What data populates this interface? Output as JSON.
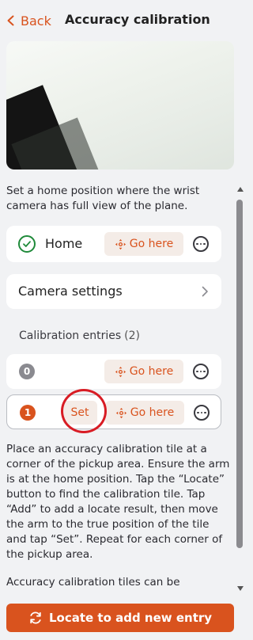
{
  "header": {
    "back_label": "Back",
    "title": "Accuracy calibration"
  },
  "intro_text": "Set a home position where the wrist camera has full view of the plane.",
  "home": {
    "label": "Home",
    "status_icon": "check-circle-icon",
    "goto_label": "Go here"
  },
  "camera_settings": {
    "label": "Camera settings"
  },
  "entries_section": {
    "title": "Calibration entries",
    "count": "(2)"
  },
  "entries": [
    {
      "index": "0",
      "goto_label": "Go here"
    },
    {
      "index": "1",
      "set_label": "Set",
      "goto_label": "Go here"
    }
  ],
  "instructions": "Place an accuracy calibration tile at a corner of the pickup area. Ensure the arm is at the home position. Tap the “Locate” button to find the calibration tile. Tap “Add” to add a locate result, then move the arm to the true position of the tile and tap “Set”. Repeat for each corner of the pickup area.",
  "footer_text": "Accuracy calibration tiles can be",
  "primary_button": {
    "label": "Locate to add new entry",
    "icon": "refresh-icon"
  },
  "colors": {
    "accent": "#d9531e",
    "success": "#1f8a3a",
    "annotation": "#d81c24",
    "background": "#f1f2f4"
  }
}
